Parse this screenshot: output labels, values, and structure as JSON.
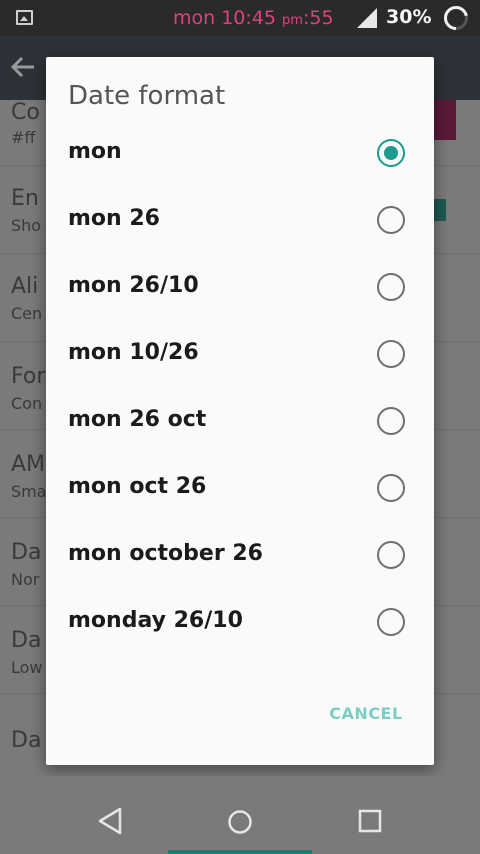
{
  "status_bar": {
    "clock_main": "mon 10:45",
    "clock_ampm": "pm",
    "clock_seconds": ":55",
    "battery_percent": "30%",
    "clock_color": "#e0407e"
  },
  "background_settings": [
    {
      "title": "Co",
      "subtitle": "#ff"
    },
    {
      "title": "En",
      "subtitle": "Sho"
    },
    {
      "title": "Ali",
      "subtitle": "Cen"
    },
    {
      "title": "For",
      "subtitle": "Con"
    },
    {
      "title": "AM",
      "subtitle": "Sma"
    },
    {
      "title": "Da",
      "subtitle": "Nor"
    },
    {
      "title": "Da",
      "subtitle": "Low"
    },
    {
      "title": "Da",
      "subtitle": ""
    }
  ],
  "dialog": {
    "title": "Date format",
    "options": [
      {
        "label": "mon",
        "checked": true
      },
      {
        "label": "mon 26",
        "checked": false
      },
      {
        "label": "mon 26/10",
        "checked": false
      },
      {
        "label": "mon 10/26",
        "checked": false
      },
      {
        "label": "mon 26 oct",
        "checked": false
      },
      {
        "label": "mon oct 26",
        "checked": false
      },
      {
        "label": "mon october 26",
        "checked": false
      },
      {
        "label": "monday 26/10",
        "checked": false
      }
    ],
    "cancel_label": "CANCEL",
    "accent_color": "#1d9a8c"
  },
  "nav_bar": {
    "icons": [
      "back-triangle-icon",
      "home-circle-icon",
      "recents-square-icon"
    ]
  }
}
